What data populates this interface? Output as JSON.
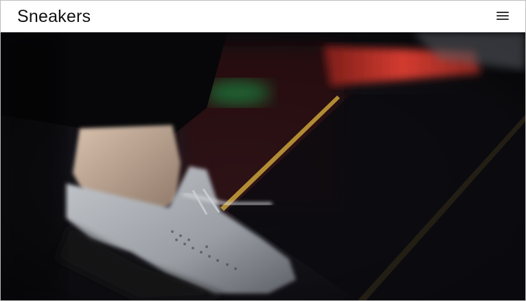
{
  "header": {
    "title": "Sneakers",
    "menu_icon": "hamburger-menu-icon"
  },
  "hero": {
    "media_type": "video-frame",
    "subject": "sneaker-on-pedal",
    "colors": {
      "background": "#0c0c10",
      "accent_stripe": "#c9a23a",
      "red_light": "#c2322a",
      "green_light": "#1f7a3a",
      "shoe": "#a9adb2",
      "skin": "#c9b09a"
    }
  }
}
